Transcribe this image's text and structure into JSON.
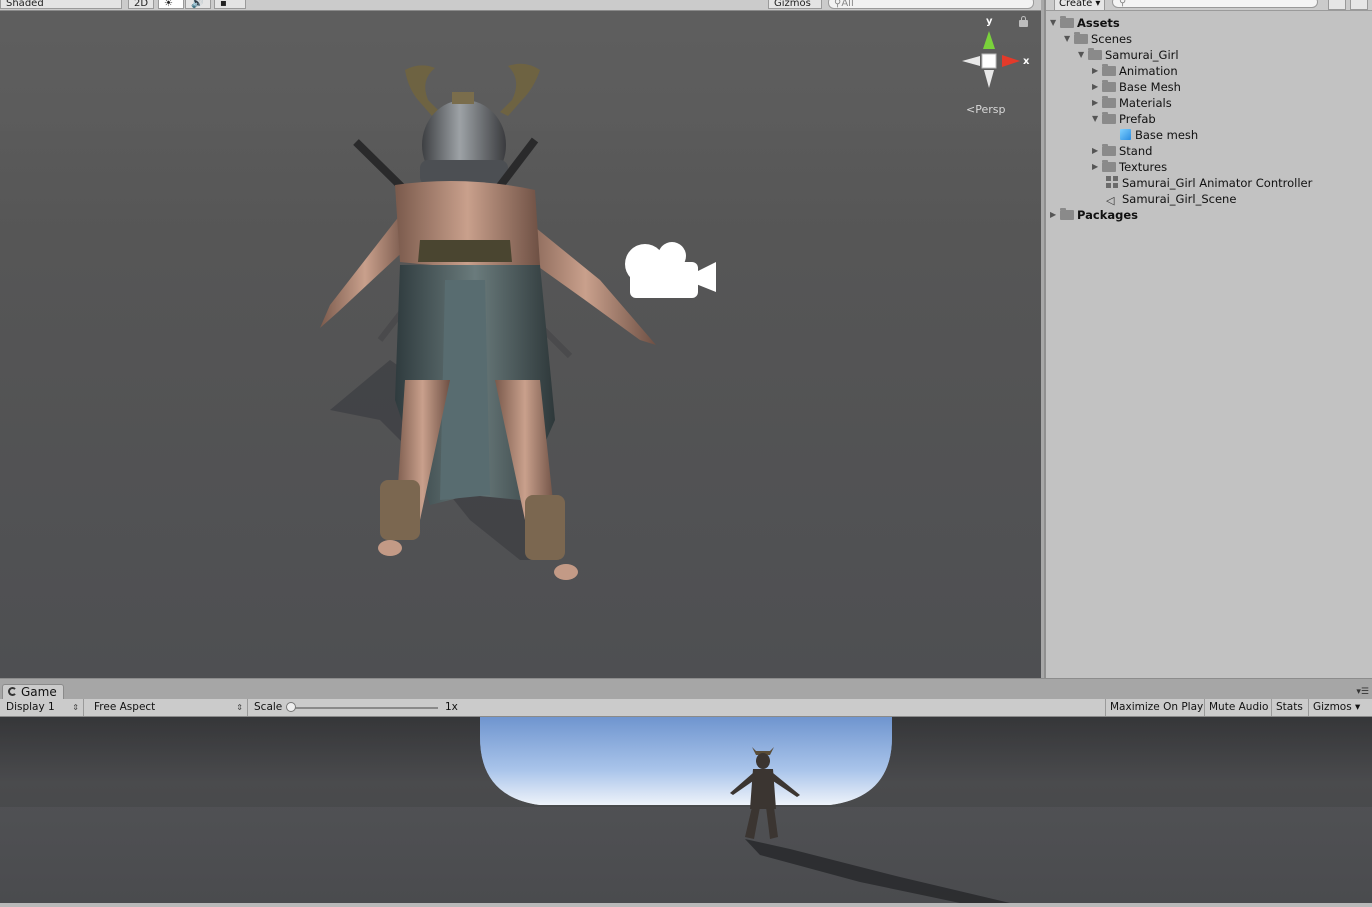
{
  "scene": {
    "toolbar": {
      "shading_mode": "Shaded",
      "mode_2d": "2D",
      "gizmos": "Gizmos",
      "search_placeholder": "All"
    },
    "gizmo_axes": {
      "y": "y",
      "x": "x"
    },
    "projection": "Persp"
  },
  "project": {
    "create": "Create",
    "tree": [
      {
        "label": "Assets",
        "bold": true
      },
      {
        "label": "Scenes"
      },
      {
        "label": "Samurai_Girl"
      },
      {
        "label": "Animation"
      },
      {
        "label": "Base Mesh"
      },
      {
        "label": "Materials"
      },
      {
        "label": "Prefab"
      },
      {
        "label": "Base mesh"
      },
      {
        "label": "Stand"
      },
      {
        "label": "Textures"
      },
      {
        "label": "Samurai_Girl Animator Controller"
      },
      {
        "label": "Samurai_Girl_Scene"
      },
      {
        "label": "Packages",
        "bold": true
      }
    ]
  },
  "game": {
    "tab_label": "Game",
    "display": "Display 1",
    "aspect": "Free Aspect",
    "scale_label": "Scale",
    "scale_value": "1x",
    "maximize_on_play": "Maximize On Play",
    "mute_audio": "Mute Audio",
    "stats": "Stats",
    "gizmos": "Gizmos"
  },
  "colors": {
    "scene_bg": "#565656",
    "panel_bg": "#c2c2c2",
    "toolbar_bg": "#cbcbcb",
    "sky": "#8fb4e4"
  }
}
